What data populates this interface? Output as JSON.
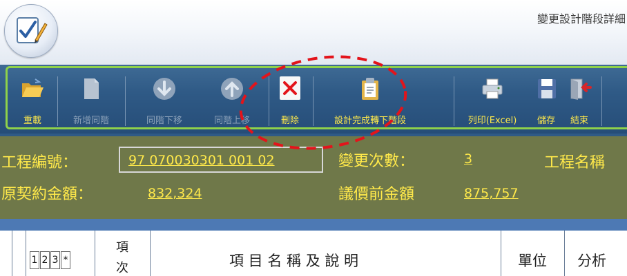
{
  "window": {
    "title": "變更設計階段詳細"
  },
  "toolbar": {
    "buttons": [
      {
        "label": "重載",
        "icon": "folder-open-icon",
        "enabled": true
      },
      {
        "label": "新增同階",
        "icon": "new-document-icon",
        "enabled": false
      },
      {
        "label": "同階下移",
        "icon": "arrow-down-icon",
        "enabled": false
      },
      {
        "label": "同階上移",
        "icon": "arrow-up-icon",
        "enabled": false
      },
      {
        "label": "刪除",
        "icon": "delete-x-icon",
        "enabled": true
      },
      {
        "label": "設計完成轉下階段",
        "icon": "clipboard-icon",
        "enabled": true
      },
      {
        "label": "列印(Excel)",
        "icon": "printer-icon",
        "enabled": true
      },
      {
        "label": "儲存",
        "icon": "floppy-disk-icon",
        "enabled": true
      },
      {
        "label": "結束",
        "icon": "exit-door-icon",
        "enabled": true
      }
    ]
  },
  "info": {
    "project_no_label": "工程編號：",
    "project_no_value": "97 070030301 001 02",
    "change_count_label": "變更次數：",
    "change_count_value": "3",
    "project_name_label": "工程名稱",
    "original_amount_label": "原契約金額：",
    "original_amount_value": "832,324",
    "pre_negotiation_label": "議價前金額",
    "pre_negotiation_value": "875,757"
  },
  "table": {
    "level_boxes": [
      "1",
      "2",
      "3",
      "*"
    ],
    "item_no_header_line1": "項",
    "item_no_header_line2": "次",
    "name_header": "項 目 名 稱 及 說 明",
    "unit_header": "單位",
    "analysis_header": "分析"
  },
  "colors": {
    "ribbon_bg": "#2f5a86",
    "label_yellow": "#ffe94a",
    "info_bg": "#6f7849",
    "annotation_red": "#e3141b"
  }
}
